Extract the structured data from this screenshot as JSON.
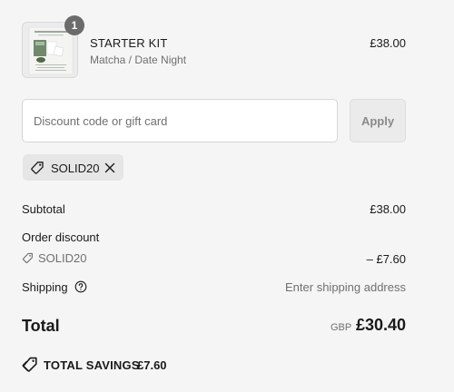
{
  "product": {
    "name": "STARTER KIT",
    "variant": "Matcha / Date Night",
    "price": "£38.00",
    "quantity": "1",
    "image_icon": "product-thumbnail"
  },
  "discount_form": {
    "placeholder": "Discount code or gift card",
    "value": "",
    "apply_label": "Apply"
  },
  "applied_discount": {
    "code": "SOLID20",
    "tag_icon": "tag-icon",
    "remove_icon": "close-icon"
  },
  "summary": {
    "subtotal_label": "Subtotal",
    "subtotal_value": "£38.00",
    "order_discount_label": "Order discount",
    "order_discount_code": "SOLID20",
    "order_discount_value": "– £7.60",
    "shipping_label": "Shipping",
    "shipping_value": "Enter shipping address",
    "shipping_help_icon": "help-icon"
  },
  "total": {
    "label": "Total",
    "currency": "GBP",
    "value": "£30.40"
  },
  "savings": {
    "label": "TOTAL SAVINGS",
    "value": "£7.60",
    "icon": "tags-icon"
  },
  "colors": {
    "background": "#f5f5f5",
    "text": "#1a1a1a",
    "muted_text": "#707070",
    "badge": "#6b6b6b",
    "chip_background": "#e6e6e6",
    "button_background": "#ebebeb"
  }
}
